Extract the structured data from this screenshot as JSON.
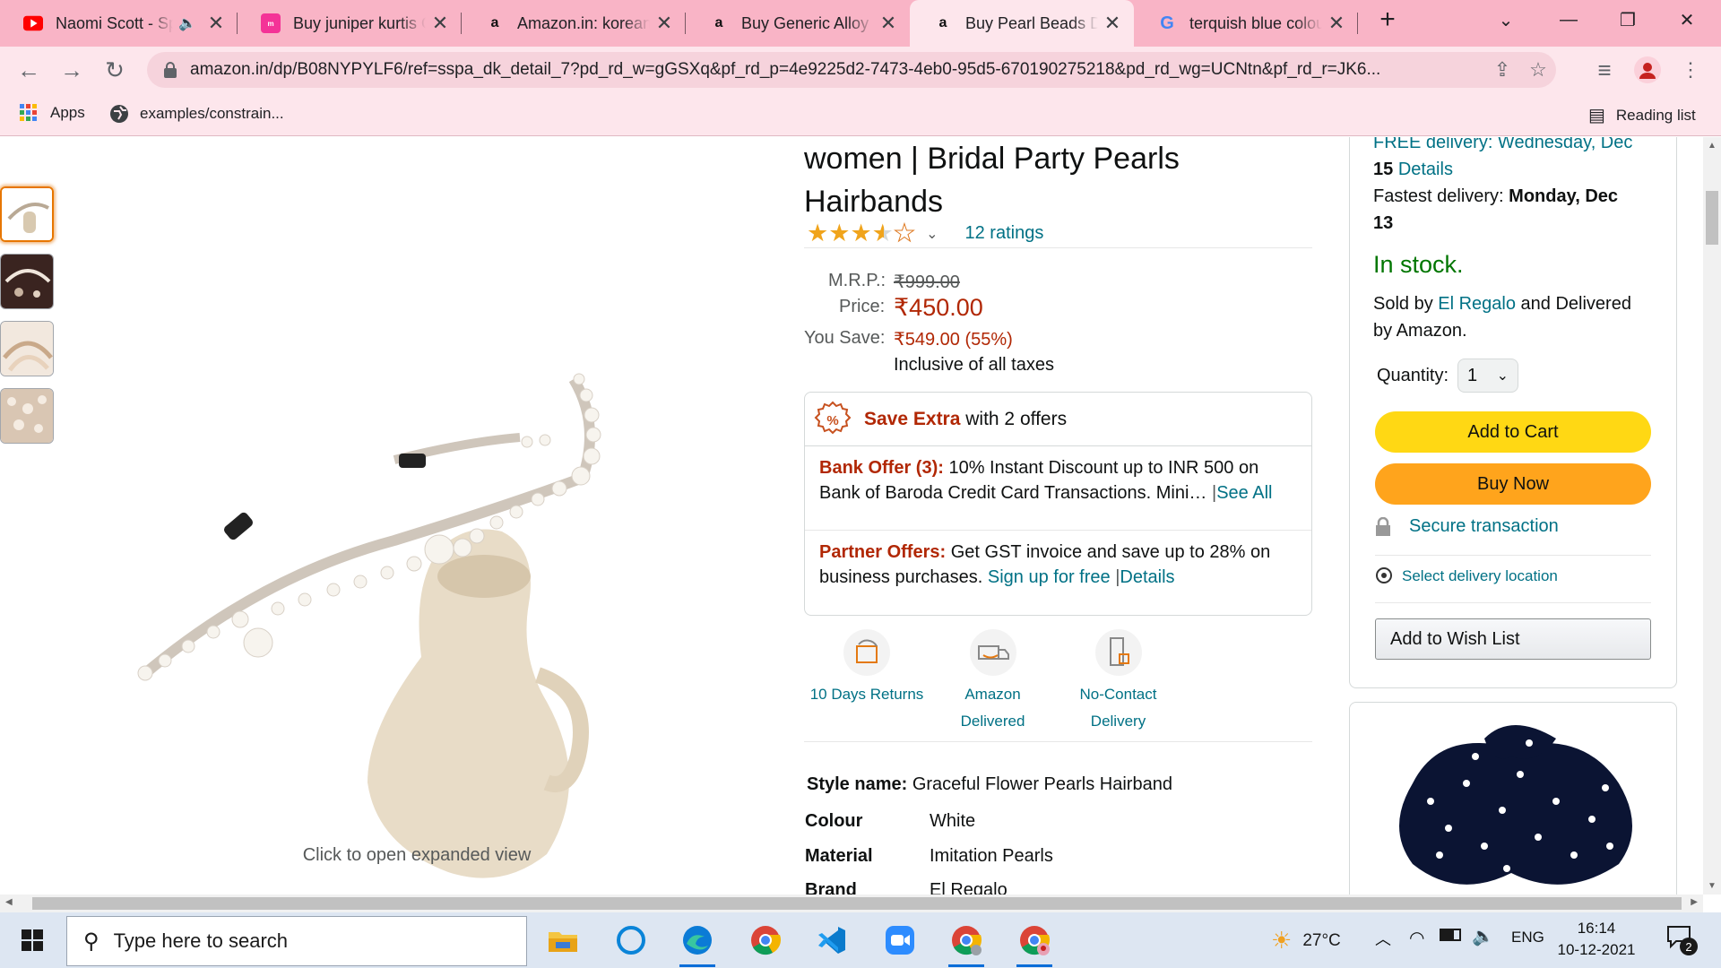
{
  "browser": {
    "tabs": [
      {
        "title": "Naomi Scott - Speechless",
        "favicon": "youtube-icon",
        "audio": true
      },
      {
        "title": "Buy juniper kurtis Online",
        "favicon": "meesho-icon"
      },
      {
        "title": "Amazon.in: korean hair",
        "favicon": "amazon-icon"
      },
      {
        "title": "Buy Generic Alloy & Pearl",
        "favicon": "amazon-icon"
      },
      {
        "title": "Buy Pearl Beads Decor",
        "favicon": "amazon-icon",
        "active": true
      },
      {
        "title": "terquish blue colour",
        "favicon": "google-icon"
      }
    ],
    "url": "amazon.in/dp/B08NYPYLF6/ref=sspa_dk_detail_7?pd_rd_w=gGSXq&pf_rd_p=4e9225d2-7473-4eb0-95d5-670190275218&pd_rd_wg=UCNtn&pf_rd_r=JK6...",
    "bookmarks": {
      "apps": "Apps",
      "examples": "examples/constrain...",
      "reading_list": "Reading list"
    }
  },
  "product": {
    "title_line1": "women | Bridal Party Pearls",
    "title_line2": "Hairbands",
    "rating_stars": 3.5,
    "ratings_count": "12 ratings",
    "mrp_label": "M.R.P.:",
    "mrp_value": "₹999.00",
    "price_label": "Price:",
    "price_value": "₹450.00",
    "save_label": "You Save:",
    "save_value": "₹549.00 (55%)",
    "tax_note": "Inclusive of all taxes",
    "image_caption": "Click to open expanded view"
  },
  "offers": {
    "head_strong": "Save Extra",
    "head_rest": " with 2 offers",
    "bank_label": "Bank Offer (3):",
    "bank_text": " 10% Instant Discount up to INR 500 on Bank of Baroda Credit Card Transactions. Mini…",
    "bank_link": "See All",
    "partner_label": "Partner Offers:",
    "partner_text": " Get GST invoice and save up to 28% on business purchases. ",
    "partner_link1": "Sign up for free",
    "partner_link2": "Details"
  },
  "features": [
    {
      "line1": "10 Days Returns",
      "line2": ""
    },
    {
      "line1": "Amazon",
      "line2": "Delivered"
    },
    {
      "line1": "No-Contact",
      "line2": "Delivery"
    }
  ],
  "specs": {
    "style_label": "Style name:",
    "style_value": "Graceful Flower Pearls Hairband",
    "rows": [
      {
        "label": "Colour",
        "value": "White"
      },
      {
        "label": "Material",
        "value": "Imitation Pearls"
      },
      {
        "label": "Brand",
        "value": "El Regalo"
      }
    ]
  },
  "buybox": {
    "delivery_partial": "FREE delivery: Wednesday, Dec",
    "delivery_date2": "15",
    "delivery_details": "Details",
    "fastest_label": "Fastest delivery: ",
    "fastest_date1": "Monday, Dec",
    "fastest_date2": "13",
    "stock": "In stock.",
    "sold_by_pre": "Sold by ",
    "seller": "El Regalo",
    "sold_by_post": " and Delivered",
    "sold_by_line2": "by Amazon.",
    "qty_label": "Quantity:",
    "qty_value": "1",
    "add_to_cart": "Add to Cart",
    "buy_now": "Buy Now",
    "secure": "Secure transaction",
    "location": "Select delivery location",
    "wishlist": "Add to Wish List"
  },
  "taskbar": {
    "search_placeholder": "Type here to search",
    "weather": "27°C",
    "lang": "ENG",
    "time": "16:14",
    "date": "10-12-2021",
    "notif_count": "2"
  },
  "colors": {
    "accent_link": "#007185",
    "price": "#b12704",
    "stock": "#007600",
    "cart": "#ffd814",
    "buy": "#ffa41c"
  }
}
